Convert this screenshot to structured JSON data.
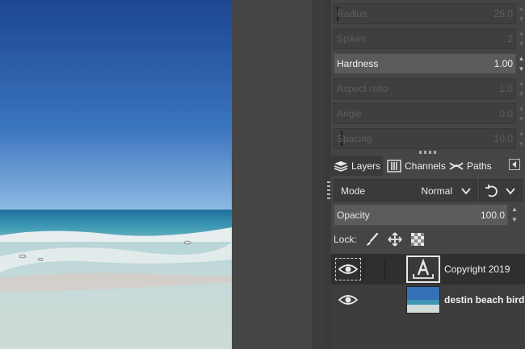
{
  "tool_options": {
    "sliders": [
      {
        "label": "Radius",
        "value": "25.0",
        "state": "dim"
      },
      {
        "label": "Spikes",
        "value": "2",
        "state": "dim"
      },
      {
        "label": "Hardness",
        "value": "1.00",
        "state": "active"
      },
      {
        "label": "Aspect ratio",
        "value": "1.0",
        "state": "dim"
      },
      {
        "label": "Angle",
        "value": "0.0",
        "state": "dim"
      },
      {
        "label": "Spacing",
        "value": "10.0",
        "state": "dim"
      }
    ]
  },
  "dock_tabs": [
    {
      "label": "Layers",
      "icon": "layers-icon",
      "active": true
    },
    {
      "label": "Channels",
      "icon": "channels-icon",
      "active": false
    },
    {
      "label": "Paths",
      "icon": "paths-icon",
      "active": false
    }
  ],
  "mode": {
    "label": "Mode",
    "value": "Normal"
  },
  "opacity": {
    "label": "Opacity",
    "value": "100.0"
  },
  "lock": {
    "label": "Lock:",
    "icons": [
      "paintbrush-icon",
      "move-icon",
      "checkerboard-icon"
    ]
  },
  "layers": [
    {
      "name": "Copyright 2019",
      "type": "text",
      "visible": true,
      "selected": true
    },
    {
      "name": "destin beach bird",
      "type": "image",
      "visible": true,
      "selected": false
    }
  ],
  "colors": {
    "panel_bg": "#454545",
    "active_slider": "#5b5b5b",
    "selected_layer": "#2f2f2f",
    "sky_top": "#1f4a92",
    "water": "#3b8fae",
    "sand": "#cfd9d6"
  }
}
